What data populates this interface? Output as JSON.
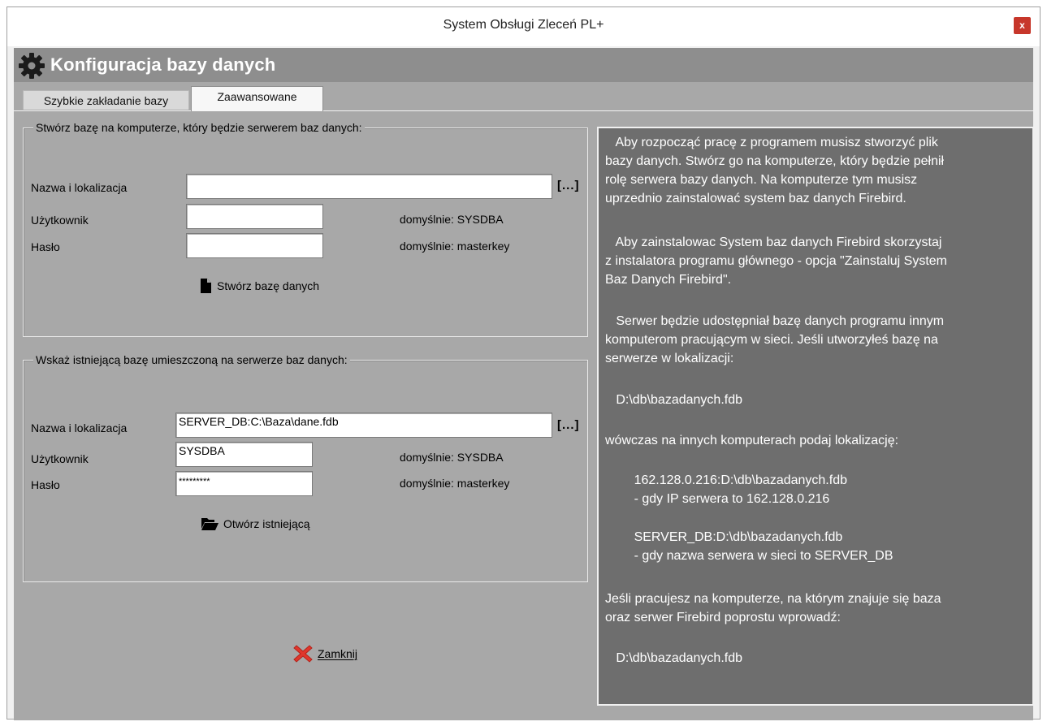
{
  "window": {
    "title": "System Obsługi Zleceń PL+",
    "close_label": "x"
  },
  "header": {
    "title": "Konfiguracja bazy danych",
    "icon": "gear-icon"
  },
  "tabs": [
    {
      "label": "Szybkie zakładanie bazy",
      "active": false
    },
    {
      "label": "Zaawansowane",
      "active": true
    }
  ],
  "create_group": {
    "legend": "Stwórz bazę na komputerze, który będzie serwerem baz danych:",
    "name_label": "Nazwa i lokalizacja",
    "name_value": "",
    "browse_label": "[...]",
    "user_label": "Użytkownik",
    "user_value": "",
    "user_default": "domyślnie: SYSDBA",
    "password_label": "Hasło",
    "password_value": "",
    "password_default": "domyślnie: masterkey",
    "button_label": "Stwórz bazę danych",
    "button_icon": "document-icon"
  },
  "open_group": {
    "legend": "Wskaż istniejącą bazę umieszczoną na serwerze baz danych:",
    "name_label": "Nazwa i lokalizacja",
    "name_value": "SERVER_DB:C:\\Baza\\dane.fdb",
    "browse_label": "[...]",
    "user_label": "Użytkownik",
    "user_value": "SYSDBA",
    "user_default": "domyślnie: SYSDBA",
    "password_label": "Hasło",
    "password_value": "*********",
    "password_default": "domyślnie: masterkey",
    "button_label": "Otwórz istniejącą",
    "button_icon": "folder-open-icon"
  },
  "close_button": {
    "label": "Zamknij",
    "icon": "red-x-icon"
  },
  "info": {
    "p1": "   Aby rozpocząć pracę z programem musisz stworzyć plik\nbazy danych. Stwórz go na komputerze, który będzie pełnił\nrolę serwera bazy danych. Na komputerze tym musisz\nuprzednio zainstalować system baz danych Firebird.",
    "p2": "   Aby zainstalowac System baz danych Firebird skorzystaj\nz instalatora programu głównego - opcja \"Zainstaluj System\nBaz Danych Firebird\".",
    "p3": "   Serwer będzie udostępniał bazę danych programu innym\nkomputerom pracującym w sieci. Jeśli utworzyłeś bazę na\nserwerze w lokalizacji:",
    "p4": "   D:\\db\\bazadanych.fdb",
    "p5": "wówczas na innych komputerach podaj lokalizację:",
    "p6": "        162.128.0.216:D:\\db\\bazadanych.fdb\n        - gdy IP serwera to 162.128.0.216",
    "p7": "        SERVER_DB:D:\\db\\bazadanych.fdb\n        - gdy nazwa serwera w sieci to SERVER_DB",
    "p8": "Jeśli pracujesz na komputerze, na którym znajuje się baza\noraz serwer Firebird poprostu wprowadź:",
    "p9": "   D:\\db\\bazadanych.fdb"
  },
  "colors": {
    "panel_bg": "#a8a8a8",
    "header_bg": "#8e8e8e",
    "info_bg": "#6e6e6e",
    "close_red": "#c7372b"
  }
}
